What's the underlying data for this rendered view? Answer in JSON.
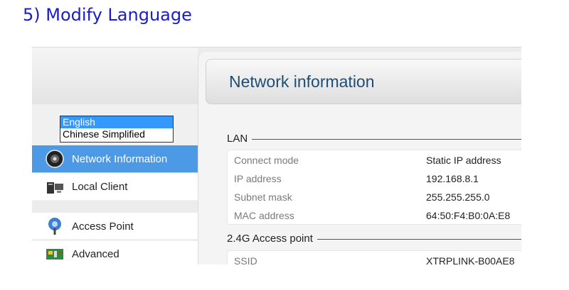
{
  "heading": "5) Modify Language",
  "language_select": {
    "options": [
      "English",
      "Chinese Simplified"
    ],
    "selected": "English"
  },
  "sidebar": {
    "items": [
      {
        "label": "Network Information",
        "icon": "network-globe-icon",
        "active": true
      },
      {
        "label": "Local Client",
        "icon": "computer-icon",
        "active": false
      },
      {
        "label": "Access Point",
        "icon": "wifi-antenna-icon",
        "active": false
      },
      {
        "label": "Advanced",
        "icon": "settings-board-icon",
        "active": false
      }
    ]
  },
  "main": {
    "title": "Network information",
    "lan": {
      "label": "LAN",
      "rows": [
        {
          "key": "Connect mode",
          "value": "Static IP address"
        },
        {
          "key": "IP address",
          "value": "192.168.8.1"
        },
        {
          "key": "Subnet mask",
          "value": "255.255.255.0"
        },
        {
          "key": "MAC address",
          "value": "64:50:F4:B0:0A:E8"
        }
      ]
    },
    "ap": {
      "label": "2.4G Access point",
      "rows": [
        {
          "key": "SSID",
          "value": "XTRPLINK-B00AE8"
        }
      ]
    }
  },
  "colors": {
    "heading": "#1c1cc6",
    "active_nav": "#4c9ae6",
    "title": "#1f4d73"
  }
}
